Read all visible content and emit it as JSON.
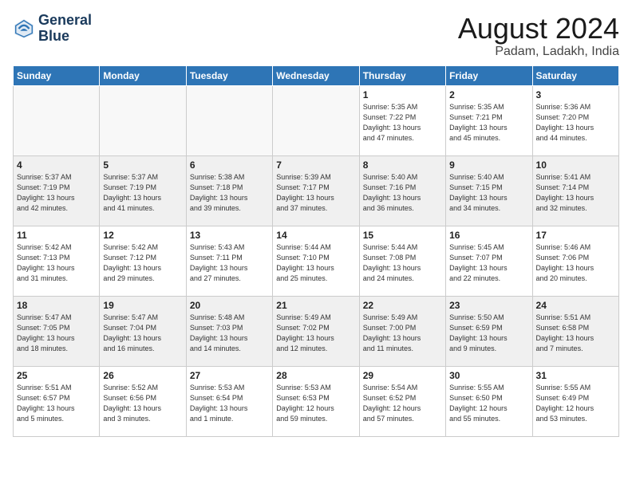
{
  "header": {
    "logo_line1": "General",
    "logo_line2": "Blue",
    "month": "August 2024",
    "location": "Padam, Ladakh, India"
  },
  "weekdays": [
    "Sunday",
    "Monday",
    "Tuesday",
    "Wednesday",
    "Thursday",
    "Friday",
    "Saturday"
  ],
  "weeks": [
    [
      {
        "day": "",
        "info": ""
      },
      {
        "day": "",
        "info": ""
      },
      {
        "day": "",
        "info": ""
      },
      {
        "day": "",
        "info": ""
      },
      {
        "day": "1",
        "info": "Sunrise: 5:35 AM\nSunset: 7:22 PM\nDaylight: 13 hours\nand 47 minutes."
      },
      {
        "day": "2",
        "info": "Sunrise: 5:35 AM\nSunset: 7:21 PM\nDaylight: 13 hours\nand 45 minutes."
      },
      {
        "day": "3",
        "info": "Sunrise: 5:36 AM\nSunset: 7:20 PM\nDaylight: 13 hours\nand 44 minutes."
      }
    ],
    [
      {
        "day": "4",
        "info": "Sunrise: 5:37 AM\nSunset: 7:19 PM\nDaylight: 13 hours\nand 42 minutes."
      },
      {
        "day": "5",
        "info": "Sunrise: 5:37 AM\nSunset: 7:19 PM\nDaylight: 13 hours\nand 41 minutes."
      },
      {
        "day": "6",
        "info": "Sunrise: 5:38 AM\nSunset: 7:18 PM\nDaylight: 13 hours\nand 39 minutes."
      },
      {
        "day": "7",
        "info": "Sunrise: 5:39 AM\nSunset: 7:17 PM\nDaylight: 13 hours\nand 37 minutes."
      },
      {
        "day": "8",
        "info": "Sunrise: 5:40 AM\nSunset: 7:16 PM\nDaylight: 13 hours\nand 36 minutes."
      },
      {
        "day": "9",
        "info": "Sunrise: 5:40 AM\nSunset: 7:15 PM\nDaylight: 13 hours\nand 34 minutes."
      },
      {
        "day": "10",
        "info": "Sunrise: 5:41 AM\nSunset: 7:14 PM\nDaylight: 13 hours\nand 32 minutes."
      }
    ],
    [
      {
        "day": "11",
        "info": "Sunrise: 5:42 AM\nSunset: 7:13 PM\nDaylight: 13 hours\nand 31 minutes."
      },
      {
        "day": "12",
        "info": "Sunrise: 5:42 AM\nSunset: 7:12 PM\nDaylight: 13 hours\nand 29 minutes."
      },
      {
        "day": "13",
        "info": "Sunrise: 5:43 AM\nSunset: 7:11 PM\nDaylight: 13 hours\nand 27 minutes."
      },
      {
        "day": "14",
        "info": "Sunrise: 5:44 AM\nSunset: 7:10 PM\nDaylight: 13 hours\nand 25 minutes."
      },
      {
        "day": "15",
        "info": "Sunrise: 5:44 AM\nSunset: 7:08 PM\nDaylight: 13 hours\nand 24 minutes."
      },
      {
        "day": "16",
        "info": "Sunrise: 5:45 AM\nSunset: 7:07 PM\nDaylight: 13 hours\nand 22 minutes."
      },
      {
        "day": "17",
        "info": "Sunrise: 5:46 AM\nSunset: 7:06 PM\nDaylight: 13 hours\nand 20 minutes."
      }
    ],
    [
      {
        "day": "18",
        "info": "Sunrise: 5:47 AM\nSunset: 7:05 PM\nDaylight: 13 hours\nand 18 minutes."
      },
      {
        "day": "19",
        "info": "Sunrise: 5:47 AM\nSunset: 7:04 PM\nDaylight: 13 hours\nand 16 minutes."
      },
      {
        "day": "20",
        "info": "Sunrise: 5:48 AM\nSunset: 7:03 PM\nDaylight: 13 hours\nand 14 minutes."
      },
      {
        "day": "21",
        "info": "Sunrise: 5:49 AM\nSunset: 7:02 PM\nDaylight: 13 hours\nand 12 minutes."
      },
      {
        "day": "22",
        "info": "Sunrise: 5:49 AM\nSunset: 7:00 PM\nDaylight: 13 hours\nand 11 minutes."
      },
      {
        "day": "23",
        "info": "Sunrise: 5:50 AM\nSunset: 6:59 PM\nDaylight: 13 hours\nand 9 minutes."
      },
      {
        "day": "24",
        "info": "Sunrise: 5:51 AM\nSunset: 6:58 PM\nDaylight: 13 hours\nand 7 minutes."
      }
    ],
    [
      {
        "day": "25",
        "info": "Sunrise: 5:51 AM\nSunset: 6:57 PM\nDaylight: 13 hours\nand 5 minutes."
      },
      {
        "day": "26",
        "info": "Sunrise: 5:52 AM\nSunset: 6:56 PM\nDaylight: 13 hours\nand 3 minutes."
      },
      {
        "day": "27",
        "info": "Sunrise: 5:53 AM\nSunset: 6:54 PM\nDaylight: 13 hours\nand 1 minute."
      },
      {
        "day": "28",
        "info": "Sunrise: 5:53 AM\nSunset: 6:53 PM\nDaylight: 12 hours\nand 59 minutes."
      },
      {
        "day": "29",
        "info": "Sunrise: 5:54 AM\nSunset: 6:52 PM\nDaylight: 12 hours\nand 57 minutes."
      },
      {
        "day": "30",
        "info": "Sunrise: 5:55 AM\nSunset: 6:50 PM\nDaylight: 12 hours\nand 55 minutes."
      },
      {
        "day": "31",
        "info": "Sunrise: 5:55 AM\nSunset: 6:49 PM\nDaylight: 12 hours\nand 53 minutes."
      }
    ]
  ]
}
